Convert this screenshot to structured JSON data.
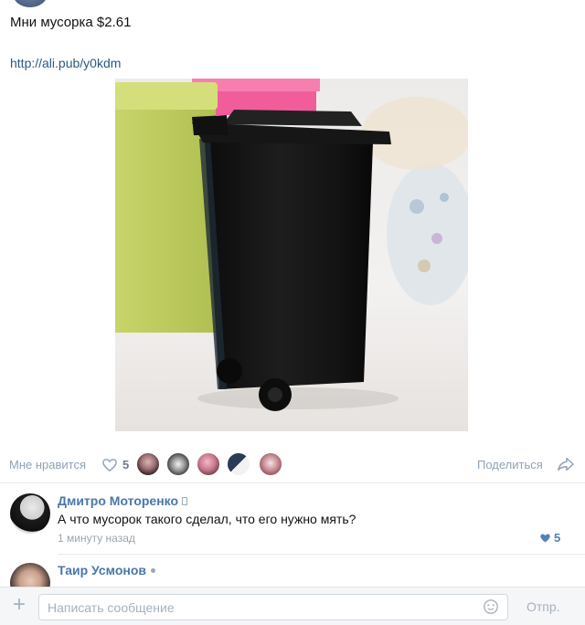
{
  "post": {
    "text": "Мни мусорка $2.61",
    "link": "http://ali.pub/y0kdm",
    "image_subject": "black mini trash bin"
  },
  "actions": {
    "like_label": "Мне нравится",
    "like_count": "5",
    "share_label": "Поделиться",
    "likers": [
      "avatar-1",
      "avatar-2",
      "avatar-3",
      "avatar-4",
      "avatar-5"
    ]
  },
  "comments": [
    {
      "author": "Дмитро Моторенко",
      "device": "mobile",
      "text": "А что мусорок такого сделал, что его нужно мять?",
      "time": "1 минуту назад",
      "likes": "5"
    },
    {
      "author": "Таир Усмонов",
      "device": "online"
    }
  ],
  "composer": {
    "placeholder": "Написать сообщение",
    "send_label": "Отпр."
  },
  "colors": {
    "link": "#2a5885",
    "author": "#4a77a8",
    "muted": "#8fa2b6",
    "like_accent": "#5181b8"
  }
}
